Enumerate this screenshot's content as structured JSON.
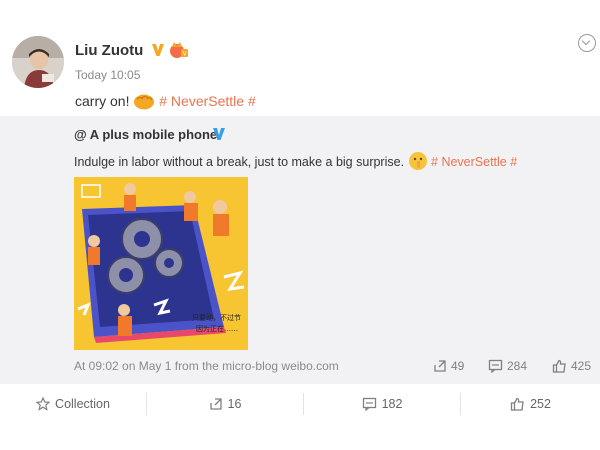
{
  "post": {
    "username": "Liu Zuotu",
    "timestamp": "Today 10:05",
    "text": "carry on!",
    "hashtag": "# NeverSettle #"
  },
  "repost": {
    "author": "@ A plus mobile phone",
    "text": "Indulge in labor without a break, just to make a big surprise.",
    "hashtag": "# NeverSettle #",
    "image_caption_line1": "只要动，不过节",
    "image_caption_line2": "因为正在……",
    "meta": "At 09:02 on May 1 from the micro-blog weibo.com",
    "stats": {
      "reposts": "49",
      "comments": "284",
      "likes": "425"
    }
  },
  "footer": {
    "collection_label": "Collection",
    "reposts": "16",
    "comments": "182",
    "likes": "252"
  },
  "icons": {
    "verified": "verified-v-icon",
    "member_badge": "member-badge-icon",
    "more": "chevron-down-circle-icon",
    "repost": "repost-icon",
    "comment": "comment-icon",
    "like": "thumbs-up-icon",
    "collection": "star-icon"
  },
  "colors": {
    "hashtag": "#eb7350",
    "verified": "#f5a623",
    "repost_verified": "#3a9ee8",
    "repost_bg": "#f2f2f5"
  }
}
